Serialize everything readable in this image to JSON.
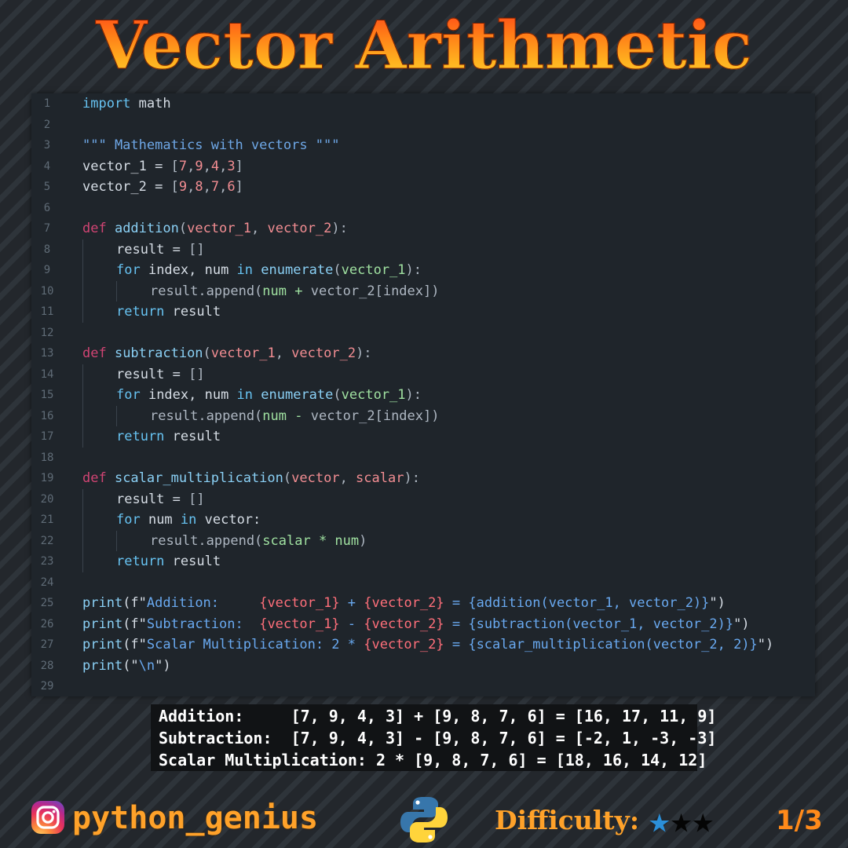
{
  "title": "Vector Arithmetic",
  "code_lines": [
    {
      "n": "1",
      "indent": 0,
      "tokens": [
        {
          "t": "import",
          "c": "kw"
        },
        {
          "t": " math",
          "c": "op"
        }
      ]
    },
    {
      "n": "2",
      "indent": 0,
      "tokens": []
    },
    {
      "n": "3",
      "indent": 0,
      "tokens": [
        {
          "t": "\"\"\" Mathematics with vectors \"\"\"",
          "c": "str"
        }
      ]
    },
    {
      "n": "4",
      "indent": 0,
      "tokens": [
        {
          "t": "vector_1 = ",
          "c": "op"
        },
        {
          "t": "[",
          "c": "dim"
        },
        {
          "t": "7",
          "c": "num"
        },
        {
          "t": ",",
          "c": "dim"
        },
        {
          "t": "9",
          "c": "num"
        },
        {
          "t": ",",
          "c": "dim"
        },
        {
          "t": "4",
          "c": "num"
        },
        {
          "t": ",",
          "c": "dim"
        },
        {
          "t": "3",
          "c": "num"
        },
        {
          "t": "]",
          "c": "dim"
        }
      ]
    },
    {
      "n": "5",
      "indent": 0,
      "tokens": [
        {
          "t": "vector_2 = ",
          "c": "op"
        },
        {
          "t": "[",
          "c": "dim"
        },
        {
          "t": "9",
          "c": "num"
        },
        {
          "t": ",",
          "c": "dim"
        },
        {
          "t": "8",
          "c": "num"
        },
        {
          "t": ",",
          "c": "dim"
        },
        {
          "t": "7",
          "c": "num"
        },
        {
          "t": ",",
          "c": "dim"
        },
        {
          "t": "6",
          "c": "num"
        },
        {
          "t": "]",
          "c": "dim"
        }
      ]
    },
    {
      "n": "6",
      "indent": 0,
      "tokens": []
    },
    {
      "n": "7",
      "indent": 0,
      "tokens": [
        {
          "t": "def",
          "c": "def"
        },
        {
          "t": " addition",
          "c": "fn"
        },
        {
          "t": "(",
          "c": "dim"
        },
        {
          "t": "vector_1",
          "c": "num"
        },
        {
          "t": ", ",
          "c": "dim"
        },
        {
          "t": "vector_2",
          "c": "num"
        },
        {
          "t": "):",
          "c": "dim"
        }
      ]
    },
    {
      "n": "8",
      "indent": 1,
      "tokens": [
        {
          "t": "result = ",
          "c": "op"
        },
        {
          "t": "[]",
          "c": "dim"
        }
      ]
    },
    {
      "n": "9",
      "indent": 1,
      "tokens": [
        {
          "t": "for",
          "c": "kw"
        },
        {
          "t": " index, num ",
          "c": "op"
        },
        {
          "t": "in",
          "c": "kw"
        },
        {
          "t": " enumerate",
          "c": "fn"
        },
        {
          "t": "(",
          "c": "dim"
        },
        {
          "t": "vector_1",
          "c": "var"
        },
        {
          "t": "):",
          "c": "dim"
        }
      ]
    },
    {
      "n": "10",
      "indent": 2,
      "tokens": [
        {
          "t": "result.append(",
          "c": "dim"
        },
        {
          "t": "num + ",
          "c": "var"
        },
        {
          "t": "vector_2[index])",
          "c": "dim"
        }
      ]
    },
    {
      "n": "11",
      "indent": 1,
      "tokens": [
        {
          "t": "return",
          "c": "kw"
        },
        {
          "t": " result",
          "c": "op"
        }
      ]
    },
    {
      "n": "12",
      "indent": 0,
      "tokens": []
    },
    {
      "n": "13",
      "indent": 0,
      "tokens": [
        {
          "t": "def",
          "c": "def"
        },
        {
          "t": " subtraction",
          "c": "fn"
        },
        {
          "t": "(",
          "c": "dim"
        },
        {
          "t": "vector_1",
          "c": "num"
        },
        {
          "t": ", ",
          "c": "dim"
        },
        {
          "t": "vector_2",
          "c": "num"
        },
        {
          "t": "):",
          "c": "dim"
        }
      ]
    },
    {
      "n": "14",
      "indent": 1,
      "tokens": [
        {
          "t": "result = ",
          "c": "op"
        },
        {
          "t": "[]",
          "c": "dim"
        }
      ]
    },
    {
      "n": "15",
      "indent": 1,
      "tokens": [
        {
          "t": "for",
          "c": "kw"
        },
        {
          "t": " index, num ",
          "c": "op"
        },
        {
          "t": "in",
          "c": "kw"
        },
        {
          "t": " enumerate",
          "c": "fn"
        },
        {
          "t": "(",
          "c": "dim"
        },
        {
          "t": "vector_1",
          "c": "var"
        },
        {
          "t": "):",
          "c": "dim"
        }
      ]
    },
    {
      "n": "16",
      "indent": 2,
      "tokens": [
        {
          "t": "result.append(",
          "c": "dim"
        },
        {
          "t": "num - ",
          "c": "var"
        },
        {
          "t": "vector_2[index])",
          "c": "dim"
        }
      ]
    },
    {
      "n": "17",
      "indent": 1,
      "tokens": [
        {
          "t": "return",
          "c": "kw"
        },
        {
          "t": " result",
          "c": "op"
        }
      ]
    },
    {
      "n": "18",
      "indent": 0,
      "tokens": []
    },
    {
      "n": "19",
      "indent": 0,
      "tokens": [
        {
          "t": "def",
          "c": "def"
        },
        {
          "t": " scalar_multiplication",
          "c": "fn"
        },
        {
          "t": "(",
          "c": "dim"
        },
        {
          "t": "vector",
          "c": "num"
        },
        {
          "t": ", ",
          "c": "dim"
        },
        {
          "t": "scalar",
          "c": "num"
        },
        {
          "t": "):",
          "c": "dim"
        }
      ]
    },
    {
      "n": "20",
      "indent": 1,
      "tokens": [
        {
          "t": "result = ",
          "c": "op"
        },
        {
          "t": "[]",
          "c": "dim"
        }
      ]
    },
    {
      "n": "21",
      "indent": 1,
      "tokens": [
        {
          "t": "for",
          "c": "kw"
        },
        {
          "t": " num ",
          "c": "op"
        },
        {
          "t": "in",
          "c": "kw"
        },
        {
          "t": " vector:",
          "c": "op"
        }
      ]
    },
    {
      "n": "22",
      "indent": 2,
      "tokens": [
        {
          "t": "result.append(",
          "c": "dim"
        },
        {
          "t": "scalar * num",
          "c": "var"
        },
        {
          "t": ")",
          "c": "dim"
        }
      ]
    },
    {
      "n": "23",
      "indent": 1,
      "tokens": [
        {
          "t": "return",
          "c": "kw"
        },
        {
          "t": " result",
          "c": "op"
        }
      ]
    },
    {
      "n": "24",
      "indent": 0,
      "tokens": []
    },
    {
      "n": "25",
      "indent": 0,
      "tokens": [
        {
          "t": "print",
          "c": "fn"
        },
        {
          "t": "(f\"",
          "c": "op"
        },
        {
          "t": "Addition:     ",
          "c": "fmt"
        },
        {
          "t": "{vector_1}",
          "c": "brace"
        },
        {
          "t": " + ",
          "c": "fmt"
        },
        {
          "t": "{vector_2}",
          "c": "brace"
        },
        {
          "t": " = ",
          "c": "fmt"
        },
        {
          "t": "{addition(vector_1, vector_2)}",
          "c": "fmt"
        },
        {
          "t": "\")",
          "c": "op"
        }
      ]
    },
    {
      "n": "26",
      "indent": 0,
      "tokens": [
        {
          "t": "print",
          "c": "fn"
        },
        {
          "t": "(f\"",
          "c": "op"
        },
        {
          "t": "Subtraction:  ",
          "c": "fmt"
        },
        {
          "t": "{vector_1}",
          "c": "brace"
        },
        {
          "t": " - ",
          "c": "fmt"
        },
        {
          "t": "{vector_2}",
          "c": "brace"
        },
        {
          "t": " = ",
          "c": "fmt"
        },
        {
          "t": "{subtraction(vector_1, vector_2)}",
          "c": "fmt"
        },
        {
          "t": "\")",
          "c": "op"
        }
      ]
    },
    {
      "n": "27",
      "indent": 0,
      "tokens": [
        {
          "t": "print",
          "c": "fn"
        },
        {
          "t": "(f\"",
          "c": "op"
        },
        {
          "t": "Scalar Multiplication: 2 * ",
          "c": "fmt"
        },
        {
          "t": "{vector_2}",
          "c": "brace"
        },
        {
          "t": " = ",
          "c": "fmt"
        },
        {
          "t": "{scalar_multiplication(vector_2, 2)}",
          "c": "fmt"
        },
        {
          "t": "\")",
          "c": "op"
        }
      ]
    },
    {
      "n": "28",
      "indent": 0,
      "tokens": [
        {
          "t": "print",
          "c": "fn"
        },
        {
          "t": "(\"",
          "c": "op"
        },
        {
          "t": "\\n",
          "c": "fmt"
        },
        {
          "t": "\")",
          "c": "op"
        }
      ]
    },
    {
      "n": "29",
      "indent": 0,
      "tokens": []
    }
  ],
  "output_lines": [
    "Addition:     [7, 9, 4, 3] + [9, 8, 7, 6] = [16, 17, 11, 9]",
    "Subtraction:  [7, 9, 4, 3] - [9, 8, 7, 6] = [-2, 1, -3, -3]",
    "Scalar Multiplication: 2 * [9, 8, 7, 6] = [18, 16, 14, 12]"
  ],
  "footer": {
    "handle": "python_genius",
    "difficulty_label": "Difficulty:",
    "difficulty_level": 1,
    "difficulty_max": 3,
    "page": "1/3",
    "icons": [
      "instagram-icon",
      "python-logo-icon"
    ]
  },
  "colors": {
    "keyword": "#67c3f2",
    "def": "#d04473",
    "number": "#f28d92",
    "string": "#6ea7e6",
    "accent_orange": "#ffa22a",
    "star_on": "#2b8fd8"
  }
}
